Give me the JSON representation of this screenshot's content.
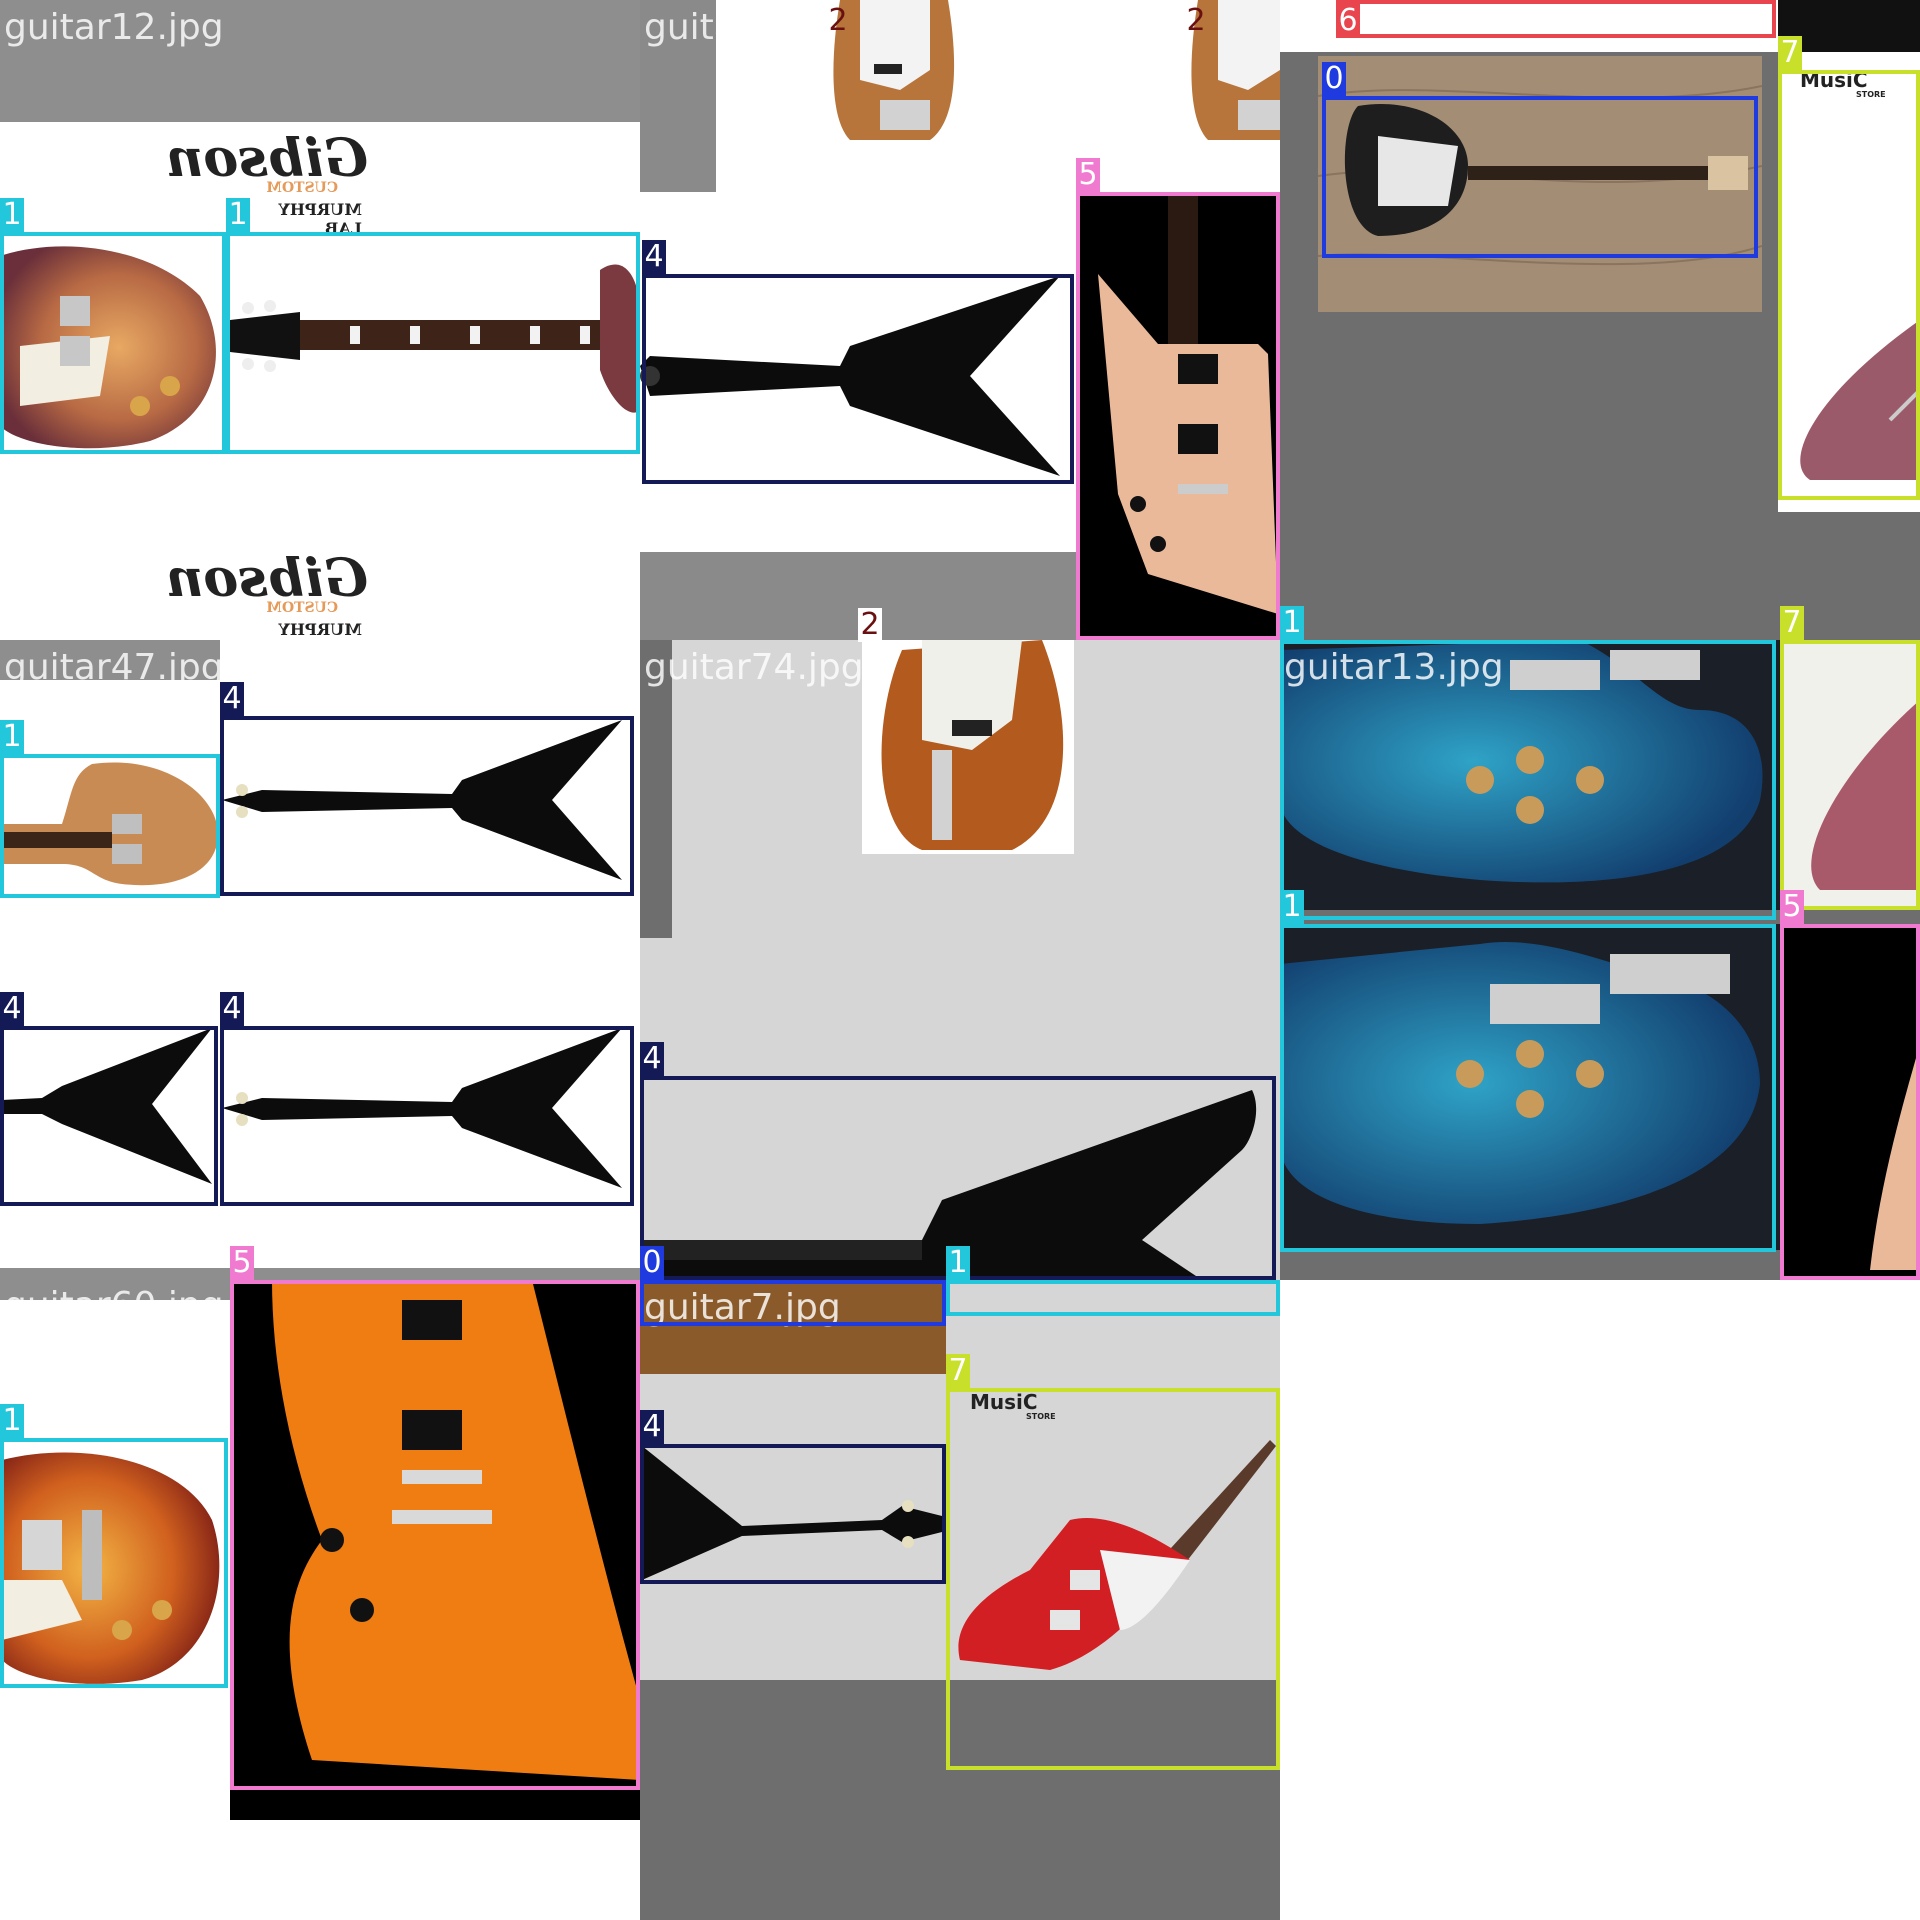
{
  "mosaic": {
    "tiles": [
      {
        "file": "guitar12.jpg"
      },
      {
        "file": "guitar22.jpg"
      },
      {
        "file": "guitar60.jpg"
      },
      {
        "file": "guitar47.jpg"
      },
      {
        "file": "guitar74.jpg"
      },
      {
        "file": "guitar13.jpg"
      },
      {
        "file": "guitar60.jpg"
      },
      {
        "file": "guitar7.jpg"
      }
    ]
  },
  "class_colors": {
    "0": "#1f3bdf",
    "1": "#22c7dc",
    "2": "#6b1010",
    "4": "#141a55",
    "5": "#f07ad0",
    "6": "#e8454f",
    "7": "#c9e02a"
  },
  "labels": {
    "c0": "0",
    "c1": "1",
    "c2": "2",
    "c4": "4",
    "c5": "5",
    "c6": "6",
    "c7": "7"
  },
  "logos": {
    "gibson_mirrored": "Gibson",
    "gibson_sub": "CUSTOM",
    "murphy_lab_mirrored": "MURPHY LAB",
    "music_store": "MusiC",
    "music_store_sub": "STORE"
  }
}
